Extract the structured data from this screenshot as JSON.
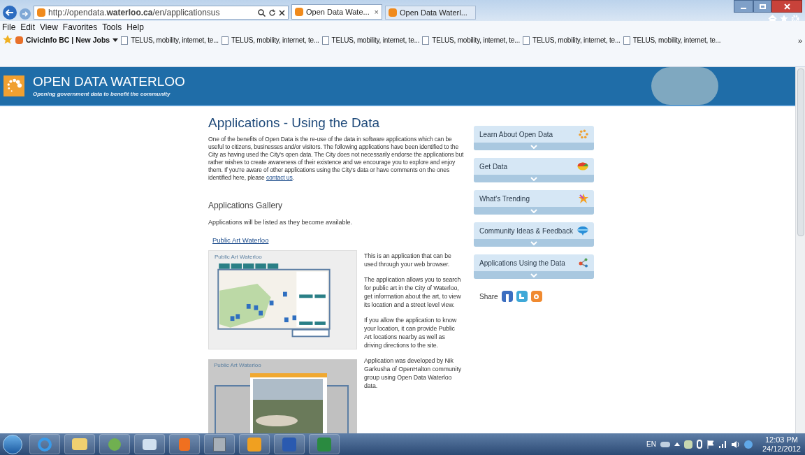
{
  "browser": {
    "address": "http://opendata.**waterloo.ca**/en/applicationsus",
    "tabs": [
      {
        "label": "Open Data Wate...",
        "selected": true,
        "close": "×"
      },
      {
        "label": "Open Data Waterl...",
        "selected": false
      }
    ],
    "menu": [
      "File",
      "Edit",
      "View",
      "Favorites",
      "Tools",
      "Help"
    ],
    "favorites": [
      {
        "label": "CivicInfo BC | New Jobs",
        "kind": "feed"
      },
      {
        "label": "TELUS, mobility, internet, te...",
        "kind": "page"
      },
      {
        "label": "TELUS, mobility, internet, te...",
        "kind": "page"
      },
      {
        "label": "TELUS, mobility, internet, te...",
        "kind": "page"
      },
      {
        "label": "TELUS, mobility, internet, te...",
        "kind": "page"
      },
      {
        "label": "TELUS, mobility, internet, te...",
        "kind": "page"
      },
      {
        "label": "TELUS, mobility, internet, te...",
        "kind": "page"
      }
    ],
    "overflow": "»"
  },
  "site": {
    "title": "OPEN DATA WATERLOO",
    "tagline": "Opening government data to benefit the community"
  },
  "page": {
    "heading": "Applications - Using the Data",
    "intro": "One of the benefits of Open Data is the re-use of the data in software applications which can be useful to citizens, businesses and/or visitors.  The following applications have been identified to the City as having used the City's open data.  The City does not necessarily endorse the applications but rather wishes to create awareness of their existence and we encourage you to explore and enjoy them.  If you're aware of other applications using the City's data or have comments on the ones identified here, please ",
    "intro_link": "contact us",
    "intro_end": ".",
    "gallery_heading": "Applications Gallery",
    "gallery_note": "Applications will be listed as they become available.",
    "apps": [
      {
        "link": "Public Art Waterloo",
        "screenshots": [
          {
            "title": "Public Art Waterloo",
            "kind": "map"
          },
          {
            "title": "Public Art Waterloo",
            "kind": "street_view"
          }
        ],
        "description": [
          "This is an application that can be used through your web browser.",
          "The application allows you to search for public art in the City of Waterloo, get information about the art, to view its location and a street level view.",
          "If you allow the application to know your location, it can provide Public Art locations nearby as well as driving directions to the site.",
          "Application was developed by Nik Garkusha of OpenHalton community group using Open Data Waterloo data."
        ]
      }
    ]
  },
  "sidebar": [
    {
      "label": "Learn About Open Data"
    },
    {
      "label": "Get Data"
    },
    {
      "label": "What's Trending"
    },
    {
      "label": "Community Ideas & Feedback"
    },
    {
      "label": "Applications Using the Data"
    }
  ],
  "share": {
    "label": "Share"
  },
  "tray": {
    "language": "EN",
    "time": "12:03 PM",
    "date": "24/12/2012"
  }
}
